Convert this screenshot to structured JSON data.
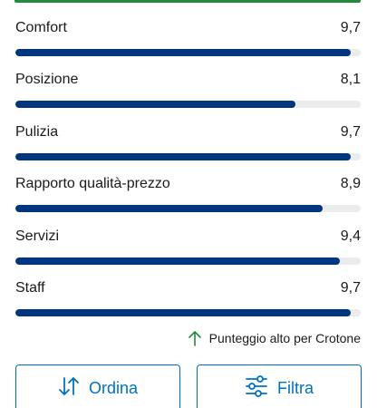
{
  "ratings": [
    {
      "label": "Comfort",
      "score": "9,7",
      "value": 9.7
    },
    {
      "label": "Posizione",
      "score": "8,1",
      "value": 8.1
    },
    {
      "label": "Pulizia",
      "score": "9,7",
      "value": 9.7
    },
    {
      "label": "Rapporto qualità-prezzo",
      "score": "8,9",
      "value": 8.9
    },
    {
      "label": "Servizi",
      "score": "9,4",
      "value": 9.4
    },
    {
      "label": "Staff",
      "score": "9,7",
      "value": 9.7
    }
  ],
  "rating_max": 10,
  "note": {
    "text": "Punteggio alto per Crotone",
    "icon": "arrow-up-icon"
  },
  "buttons": {
    "sort_label": "Ordina",
    "sort_icon": "sort-arrows-icon",
    "filter_label": "Filtra",
    "filter_icon": "sliders-icon"
  },
  "colors": {
    "bar_fill": "#003580",
    "bar_track": "#ececec",
    "accent": "#0071c2",
    "positive": "#1f8b3c"
  }
}
